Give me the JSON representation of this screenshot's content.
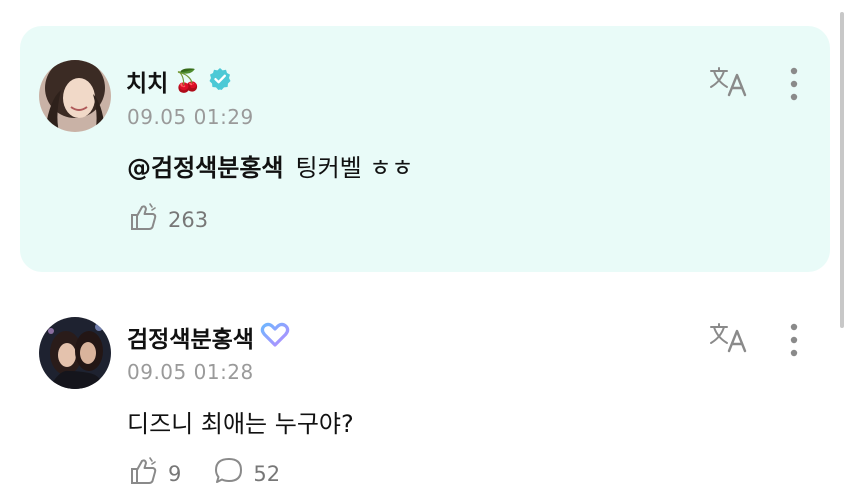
{
  "comments": [
    {
      "author": "치치",
      "author_emoji": "🍒",
      "verified_badge": "verified-badge-icon",
      "timestamp": "09.05 01:29",
      "mention": "@검정색분홍색",
      "text": "팅커벨 ㅎㅎ",
      "likes": "263",
      "highlight_color": "#e9fbf8"
    },
    {
      "author": "검정색분홍색",
      "badge": "heart-badge-icon",
      "timestamp": "09.05 01:28",
      "text": "디즈니 최애는 누구야?",
      "likes": "9",
      "replies": "52"
    }
  ],
  "icons": {
    "translate": "translate-icon",
    "more": "more-vertical-icon",
    "like": "like-icon",
    "reply": "comment-icon"
  }
}
